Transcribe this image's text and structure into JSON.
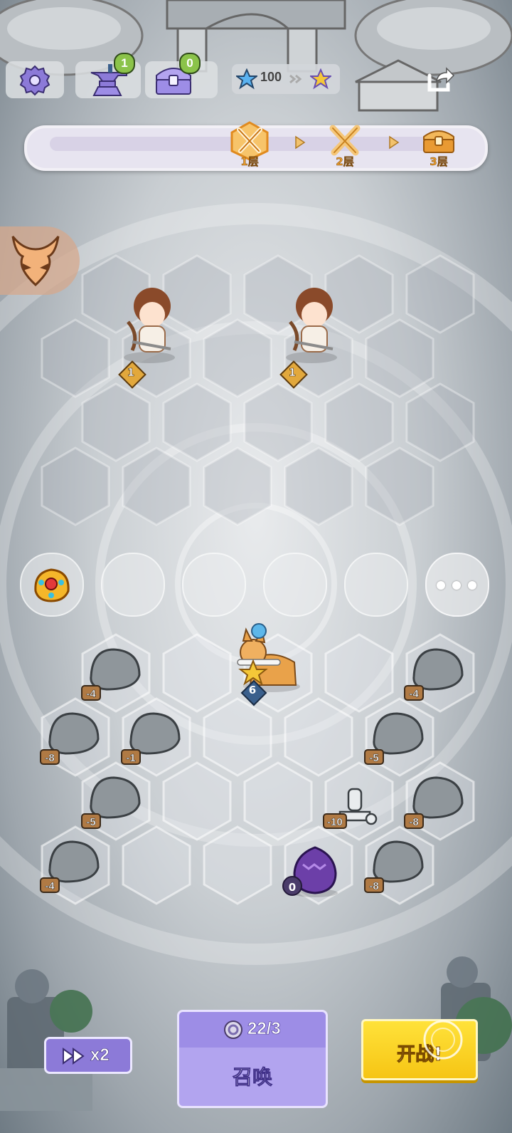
{
  "topbar": {
    "settings_icon": "gear-icon",
    "forge_icon": "anvil-icon",
    "forge_count": "1",
    "chest_icon": "treasure-chest-icon",
    "chest_count": "0",
    "stars": "100",
    "share_icon": "share-icon"
  },
  "progress": {
    "current_floor_index": 0,
    "floors": [
      {
        "label": "1层",
        "icon": "crossed-swords-icon",
        "active": true
      },
      {
        "label": "2层",
        "icon": "crossed-swords-icon",
        "active": false
      },
      {
        "label": "3层",
        "icon": "treasure-chest-icon",
        "active": false
      }
    ]
  },
  "enemy_side": {
    "tab_icon": "devil-mask-icon",
    "units": [
      {
        "name": "archer-girl",
        "level": "1"
      },
      {
        "name": "archer-girl",
        "level": "1"
      }
    ]
  },
  "relic_slots": {
    "first_item_icon": "jeweled-crown-icon",
    "more_icon": "more-dots-icon"
  },
  "player_side": {
    "hero": {
      "name": "corgi-rider",
      "level": "6",
      "star": true
    },
    "rocks": [
      "-4",
      "-4",
      "-8",
      "-1",
      "-5",
      "-5",
      "-10",
      "-8",
      "-4",
      "-8"
    ],
    "egg": {
      "icon": "purple-egg-icon",
      "count": "0"
    }
  },
  "bottom": {
    "speed_label": "x2",
    "summon_cost": "22/3",
    "summon_label": "召唤",
    "fight_label": "开战!"
  },
  "colors": {
    "accent_purple": "#9d8de6",
    "fight_yellow": "#f6c514",
    "floor_orange": "#e89b2c"
  }
}
